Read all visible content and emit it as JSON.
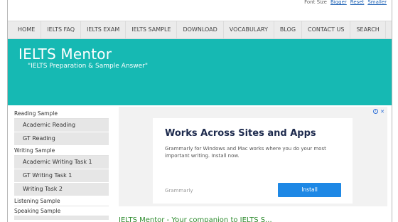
{
  "font_bar": {
    "label": "Font Size",
    "bigger": "Bigger",
    "reset": "Reset",
    "smaller": "Smaller"
  },
  "nav": [
    "HOME",
    "IELTS FAQ",
    "IELTS EXAM",
    "IELTS SAMPLE",
    "DOWNLOAD",
    "VOCABULARY",
    "BLOG",
    "CONTACT US",
    "SEARCH"
  ],
  "banner": {
    "title": "IELTS Mentor",
    "tagline": "\"IELTS Preparation & Sample Answer\""
  },
  "sidebar": {
    "reading_head": "Reading Sample",
    "reading_links": [
      "Academic Reading",
      "GT Reading"
    ],
    "writing_head": "Writing Sample",
    "writing_links": [
      "Academic Writing Task 1",
      "GT Writing Task 1",
      "Writing Task 2"
    ],
    "listening_head": "Listening Sample",
    "speaking_head": "Speaking Sample"
  },
  "ad": {
    "title": "Works Across Sites and Apps",
    "body": "Grammarly for Windows and Mac works where you do your most important writing. Install now.",
    "brand": "Grammarly",
    "button": "Install"
  },
  "page_heading": "IELTS Mentor - Your companion to IELTS S..."
}
